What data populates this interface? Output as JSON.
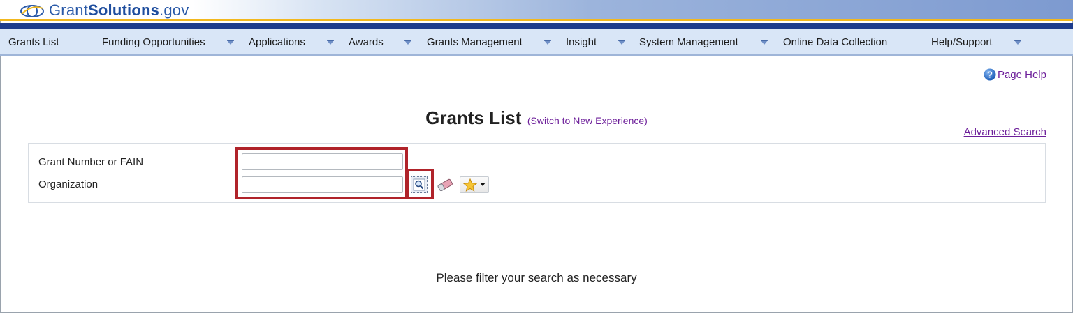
{
  "header": {
    "logo_part1": "Grant",
    "logo_part2": "Solutions",
    "logo_part3": ".gov"
  },
  "nav": {
    "items": [
      {
        "label": "Grants List",
        "has_dropdown": false
      },
      {
        "label": "Funding Opportunities",
        "has_dropdown": true
      },
      {
        "label": "Applications",
        "has_dropdown": true
      },
      {
        "label": "Awards",
        "has_dropdown": true
      },
      {
        "label": "Grants Management",
        "has_dropdown": true
      },
      {
        "label": "Insight",
        "has_dropdown": true
      },
      {
        "label": "System Management",
        "has_dropdown": true
      },
      {
        "label": "Online Data Collection",
        "has_dropdown": false
      },
      {
        "label": "Help/Support",
        "has_dropdown": true
      }
    ]
  },
  "page_help": {
    "label": "Page Help",
    "icon": "help-icon"
  },
  "main": {
    "title": "Grants List",
    "switch_link": "(Switch to New Experience)",
    "advanced_search": "Advanced Search"
  },
  "filter": {
    "grant_number_label": "Grant Number or FAIN",
    "grant_number_value": "",
    "organization_label": "Organization",
    "organization_value": "",
    "search_icon": "magnifier-icon",
    "clear_icon": "eraser-icon",
    "favorites_icon": "star-icon"
  },
  "status_message": "Please filter your search as necessary",
  "colors": {
    "nav_bg": "#d9e6f7",
    "accent_gold": "#f2b81e",
    "accent_navy": "#1d3c8c",
    "link": "#6d1f9a",
    "highlight": "#b0232a"
  }
}
